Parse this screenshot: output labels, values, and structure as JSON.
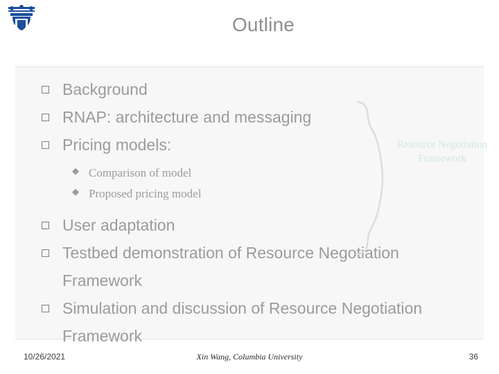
{
  "slide": {
    "title": "Outline",
    "logo_icon": "columbia-crown-logo-icon",
    "bullets": [
      {
        "level": 1,
        "text": "Background"
      },
      {
        "level": 1,
        "text": "RNAP: architecture and messaging"
      },
      {
        "level": 1,
        "text": "Pricing models:"
      },
      {
        "level": 2,
        "text": "Comparison of model"
      },
      {
        "level": 2,
        "text": "Proposed pricing model"
      },
      {
        "level": 1,
        "text": "User adaptation"
      },
      {
        "level": 1,
        "text": "Testbed demonstration of Resource Negotiation Framework"
      },
      {
        "level": 1,
        "text": "Simulation and discussion of Resource Negotiation Framework"
      }
    ],
    "callout": {
      "line1": "Resource Negotiation",
      "line2": "Framework",
      "color": "#cfe9d8"
    },
    "footer": {
      "date": "10/26/2021",
      "center": "Xin Wang, Columbia University",
      "page": "36"
    }
  }
}
